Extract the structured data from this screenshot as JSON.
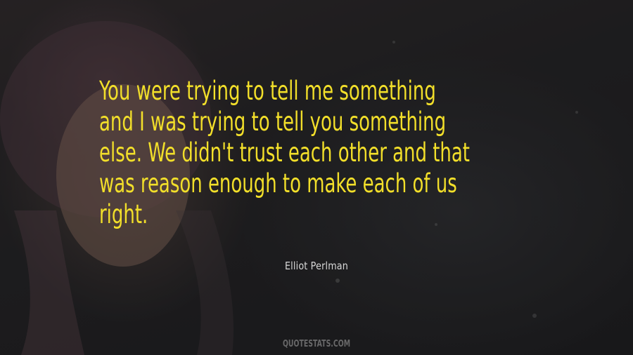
{
  "quote": {
    "text": "You were trying to tell me something\nand I was trying to tell you something\nelse. We didn't trust each other and that\nwas reason enough to make each of us\nright.",
    "author": "Elliot Perlman"
  },
  "watermark": "QUOTESTATS.COM",
  "colors": {
    "quote": "#f2df2a",
    "author": "#d8d8d8"
  }
}
